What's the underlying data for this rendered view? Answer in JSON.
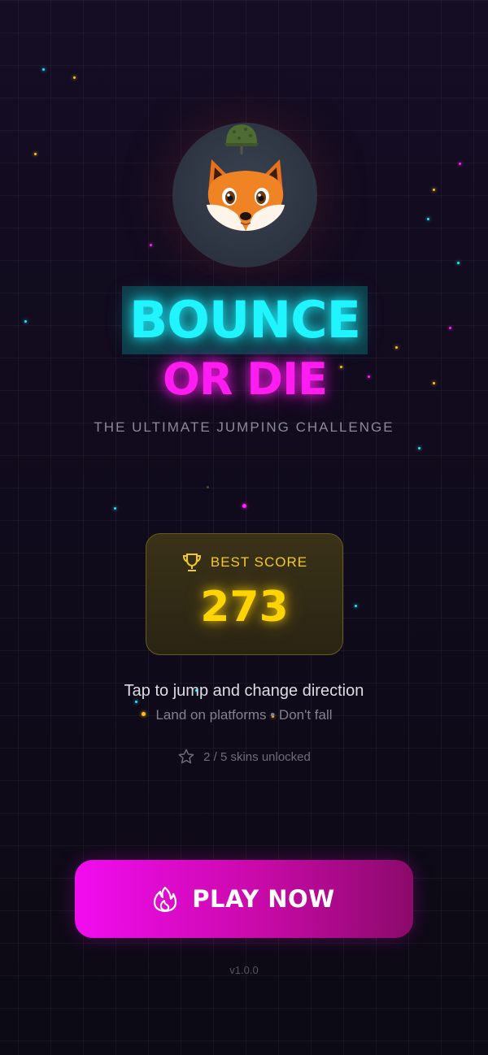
{
  "title": {
    "line1": "BOUNCE",
    "line2": "OR DIE"
  },
  "tagline": "THE ULTIMATE JUMPING CHALLENGE",
  "best_score": {
    "label": "BEST SCORE",
    "value": "273"
  },
  "instructions": {
    "main": "Tap to jump and change direction",
    "sub": "Land on platforms • Don't fall"
  },
  "skins": {
    "text": "2 / 5 skins unlocked",
    "icon": "star-outline-icon"
  },
  "play_button": {
    "label": "PLAY NOW",
    "icon": "flame-icon"
  },
  "version": "v1.0.0",
  "character": {
    "icon": "fox-icon",
    "accessory": "army-helmet-icon"
  },
  "colors": {
    "title1": "#1ff4ff",
    "title2": "#ff1cf1",
    "score": "#ffd400",
    "play_button": "#f20cf0"
  }
}
